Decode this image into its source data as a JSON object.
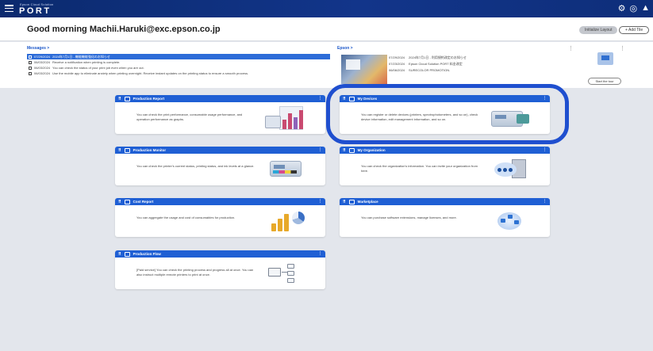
{
  "topbar": {
    "brand_small": "Epson Cloud Solution",
    "brand": "PORT",
    "icons": [
      "help-icon",
      "notification-icon",
      "user-icon"
    ]
  },
  "header": {
    "greeting": "Good morning Machii.Haruki@exc.epson.co.jp",
    "initialize_layout_label": "Initialize Layout",
    "add_tile_label": "+ Add Tile"
  },
  "messages": {
    "link_label": "Messages >",
    "items": [
      {
        "date": "07/29/2024",
        "text": "2024年7月1日 - 機能機能強化のお知らせ",
        "selected": true
      },
      {
        "date": "06/03/2024",
        "text": "Receive a notification when printing is complete.",
        "selected": false
      },
      {
        "date": "06/03/2024",
        "text": "You can check the status of your print job even when you are out.",
        "selected": false
      },
      {
        "date": "06/03/2024",
        "text": "Use the mobile app to eliminate anxiety when printing overnight. Receive instant updates on the printing status to ensure a smooth process.",
        "selected": false
      }
    ]
  },
  "news": {
    "link_label": "Epson >",
    "items": [
      {
        "date": "07/29/2024",
        "text": "2024年7月1日 - 利用規約改定のお知らせ"
      },
      {
        "date": "07/23/2024",
        "text": "Epson Cloud Solution PORT 料金改定"
      },
      {
        "date": "06/06/2024",
        "text": "SURECOLOR PROMOTION."
      }
    ]
  },
  "tour": {
    "button_label": "Start the tour"
  },
  "tiles": {
    "production_report": {
      "title": "Production Report",
      "desc": "You can check the print performance, consumable usage performance, and operation performance as graphs."
    },
    "my_devices": {
      "title": "My Devices",
      "desc": "You can register or delete devices (printers, spectrophotometers, and so on), check device information, edit management information, and so on."
    },
    "production_monitor": {
      "title": "Production Monitor",
      "desc": "You can check the printer's current status, printing status, and ink levels at a glance."
    },
    "my_organization": {
      "title": "My Organization",
      "desc": "You can check the organization's information. You can invite your organization from here."
    },
    "cost_report": {
      "title": "Cost Report",
      "desc": "You can aggregate the usage and cost of consumables for production."
    },
    "marketplace": {
      "title": "Marketplace",
      "desc": "You can purchase software extensions, manage licenses, and more."
    },
    "production_flow": {
      "title": "Production Flow",
      "desc": "[Paid service] You can check the printing process and progress all at once. You can also instruct multiple remote printers to print at once."
    }
  },
  "colors": {
    "topbar": "#0b2a6e",
    "tile_header": "#1f5fd4",
    "highlight": "#1f4fcf",
    "page_bg": "#e3e6ec"
  }
}
